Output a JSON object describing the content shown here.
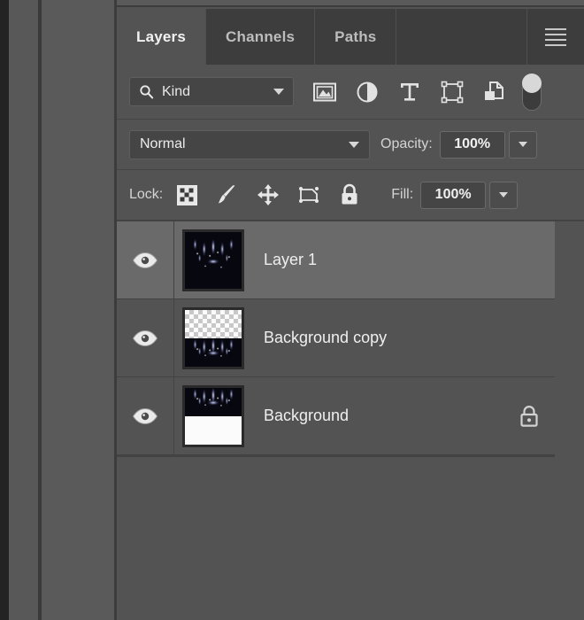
{
  "panel": {
    "tabs": [
      {
        "label": "Layers",
        "active": true
      },
      {
        "label": "Channels",
        "active": false
      },
      {
        "label": "Paths",
        "active": false
      }
    ],
    "menu_icon": "hamburger-menu-icon"
  },
  "filter": {
    "kind_label": "Kind",
    "search_icon": "search-icon",
    "dropdown_icon": "chevron-down-icon",
    "icons": [
      {
        "name": "filter-pixel-layers-icon",
        "title": "Pixel Layers"
      },
      {
        "name": "filter-adjustment-layers-icon",
        "title": "Adjustment Layers"
      },
      {
        "name": "filter-type-layers-icon",
        "title": "Type Layers"
      },
      {
        "name": "filter-shape-layers-icon",
        "title": "Shape Layers"
      },
      {
        "name": "filter-smart-objects-icon",
        "title": "Smart Objects"
      }
    ],
    "toggle_name": "filter-enable-toggle"
  },
  "blend": {
    "mode": "Normal",
    "mode_dropdown_icon": "chevron-down-icon",
    "opacity_label": "Opacity:",
    "opacity_value": "100%",
    "opacity_dropdown_icon": "chevron-down-icon"
  },
  "lock": {
    "label": "Lock:",
    "icons": [
      {
        "name": "lock-transparent-pixels-icon",
        "title": "Lock transparent pixels"
      },
      {
        "name": "lock-image-pixels-icon",
        "title": "Lock image pixels"
      },
      {
        "name": "lock-position-icon",
        "title": "Lock position"
      },
      {
        "name": "lock-artboard-nesting-icon",
        "title": "Prevent auto-nesting"
      },
      {
        "name": "lock-all-icon",
        "title": "Lock all"
      }
    ],
    "fill_label": "Fill:",
    "fill_value": "100%",
    "fill_dropdown_icon": "chevron-down-icon"
  },
  "layers": [
    {
      "name": "Layer 1",
      "visible": true,
      "selected": true,
      "locked": false,
      "thumbnail": "art-full",
      "eye_icon": "eye-visibility-icon"
    },
    {
      "name": "Background copy",
      "visible": true,
      "selected": false,
      "locked": false,
      "thumbnail": "checker-top-art-bottom",
      "eye_icon": "eye-visibility-icon"
    },
    {
      "name": "Background",
      "visible": true,
      "selected": false,
      "locked": true,
      "thumbnail": "art-top-white-bottom",
      "eye_icon": "eye-visibility-icon",
      "lock_icon": "padlock-icon"
    }
  ],
  "colors": {
    "panel_bg": "#535353",
    "tabbar_bg": "#3d3d3d",
    "selected_row": "#6a6a6a",
    "text": "#efefef",
    "muted_text": "#bdbdbd",
    "field_bg": "#454545",
    "border": "#434343"
  }
}
